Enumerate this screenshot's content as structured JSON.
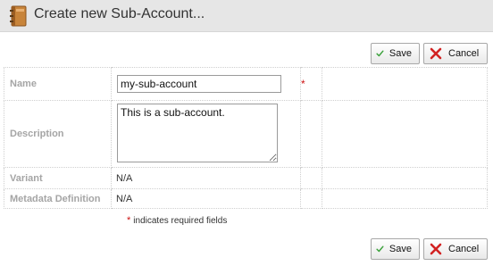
{
  "header": {
    "title": "Create new Sub-Account..."
  },
  "toolbar": {
    "save_label": "Save",
    "cancel_label": "Cancel"
  },
  "form": {
    "name": {
      "label": "Name",
      "value": "my-sub-account",
      "required_mark": "*"
    },
    "description": {
      "label": "Description",
      "value": "This is a sub-account."
    },
    "variant": {
      "label": "Variant",
      "value": "N/A"
    },
    "metadata": {
      "label": "Metadata Definition",
      "value": "N/A"
    }
  },
  "legend": {
    "mark": "*",
    "text": "indicates required fields"
  },
  "colors": {
    "accent_save": "#3aa13a",
    "accent_cancel": "#d22222",
    "required": "#cc1111"
  }
}
